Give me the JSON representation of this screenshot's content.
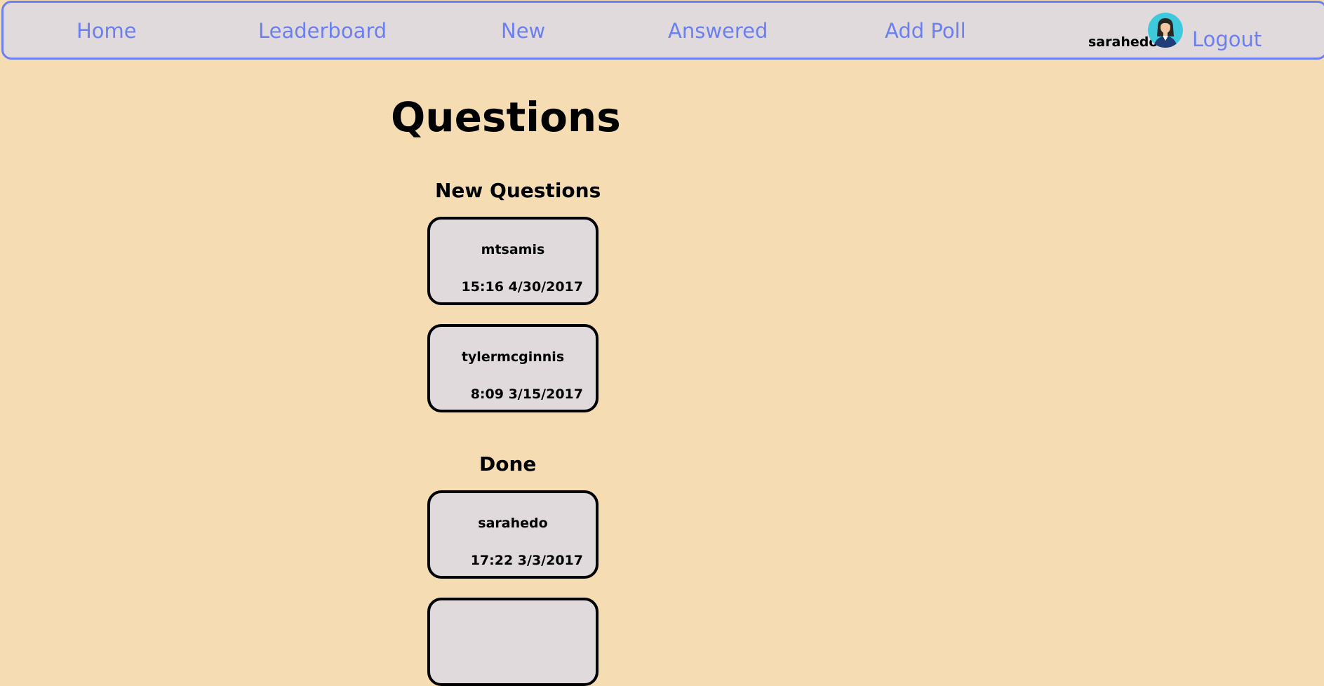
{
  "nav": {
    "home": "Home",
    "leaderboard": "Leaderboard",
    "new": "New",
    "answered": "Answered",
    "add_poll": "Add Poll",
    "username": "sarahedo",
    "logout": "Logout",
    "link_color": "#6b7ff0"
  },
  "main": {
    "title": "Questions",
    "new_section": {
      "heading": "New Questions",
      "cards": [
        {
          "author": "mtsamis",
          "time": "15:16 4/30/2017"
        },
        {
          "author": "tylermcginnis",
          "time": "8:09 3/15/2017"
        }
      ]
    },
    "done_section": {
      "heading": "Done",
      "cards": [
        {
          "author": "sarahedo",
          "time": "17:22 3/3/2017"
        },
        {
          "author": "",
          "time": ""
        }
      ]
    }
  },
  "colors": {
    "page_background": "#f5dcb2",
    "card_background": "#e0dadc",
    "navbar_border": "#6b7ff0"
  },
  "icons": {
    "avatar": "user-avatar-icon"
  }
}
